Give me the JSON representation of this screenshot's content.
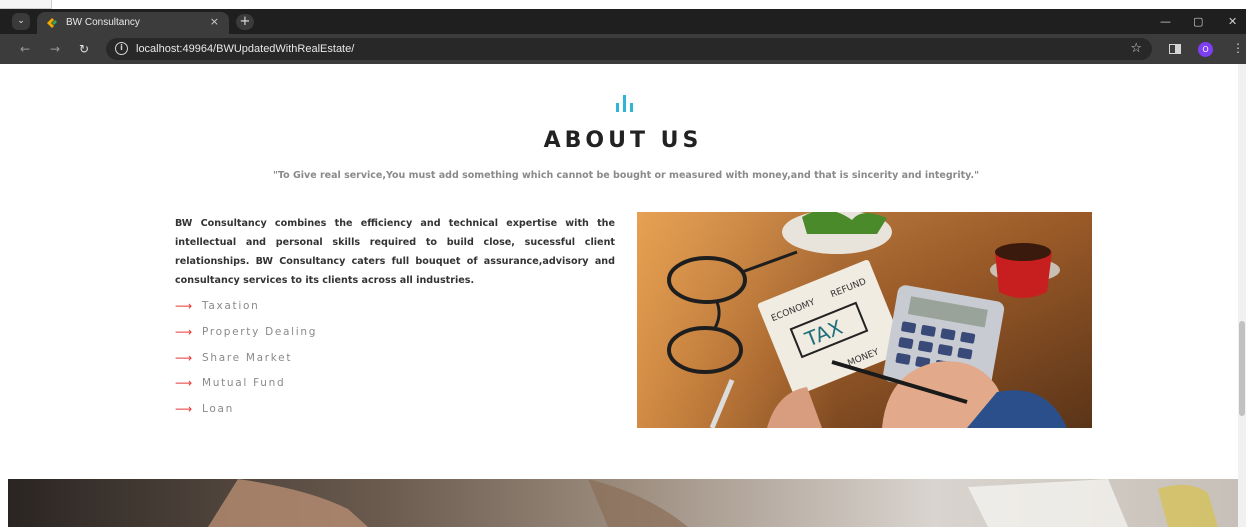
{
  "browser": {
    "tab_title": "BW Consultancy",
    "tab_close": "×",
    "new_tab": "+",
    "menu_glyph": "⌄",
    "url": "localhost:49964/BWUpdatedWithRealEstate/",
    "profile_initial": "O",
    "controls": {
      "minimize": "—",
      "restore": "▢",
      "close": "✕"
    },
    "nav": {
      "back": "←",
      "forward": "→",
      "reload": "↻"
    },
    "icons": [
      "tab-menu-icon",
      "favicon-icon",
      "info-icon",
      "star-icon",
      "side-panel-icon",
      "kebab-menu-icon"
    ]
  },
  "about": {
    "title": "ABOUT US",
    "quote": "\"To Give real service,You must add something which cannot be bought or measured with money,and that is sincerity and integrity.\"",
    "intro": "BW Consultancy combines the efficiency and technical expertise with the intellectual and personal skills required to build close, sucessful client relationships. BW Consultancy caters full bouquet of assurance,advisory and consultancy services to its clients across all industries.",
    "services": [
      {
        "label": "Taxation"
      },
      {
        "label": "Property Dealing"
      },
      {
        "label": "Share Market"
      },
      {
        "label": "Mutual Fund"
      },
      {
        "label": "Loan"
      }
    ],
    "bullet": "⟶",
    "photo_note": {
      "top_left": "ECONOMY",
      "top_right": "REFUND",
      "center": "TAX",
      "bottom": "MONEY"
    }
  },
  "colors": {
    "accent_cyan": "#2fb5d6",
    "bullet_red": "#e53935",
    "heading": "#222222",
    "muted_text": "#8a8a8a",
    "chrome_dark": "#1f1f1f",
    "profile_purple": "#7e3ff2"
  }
}
